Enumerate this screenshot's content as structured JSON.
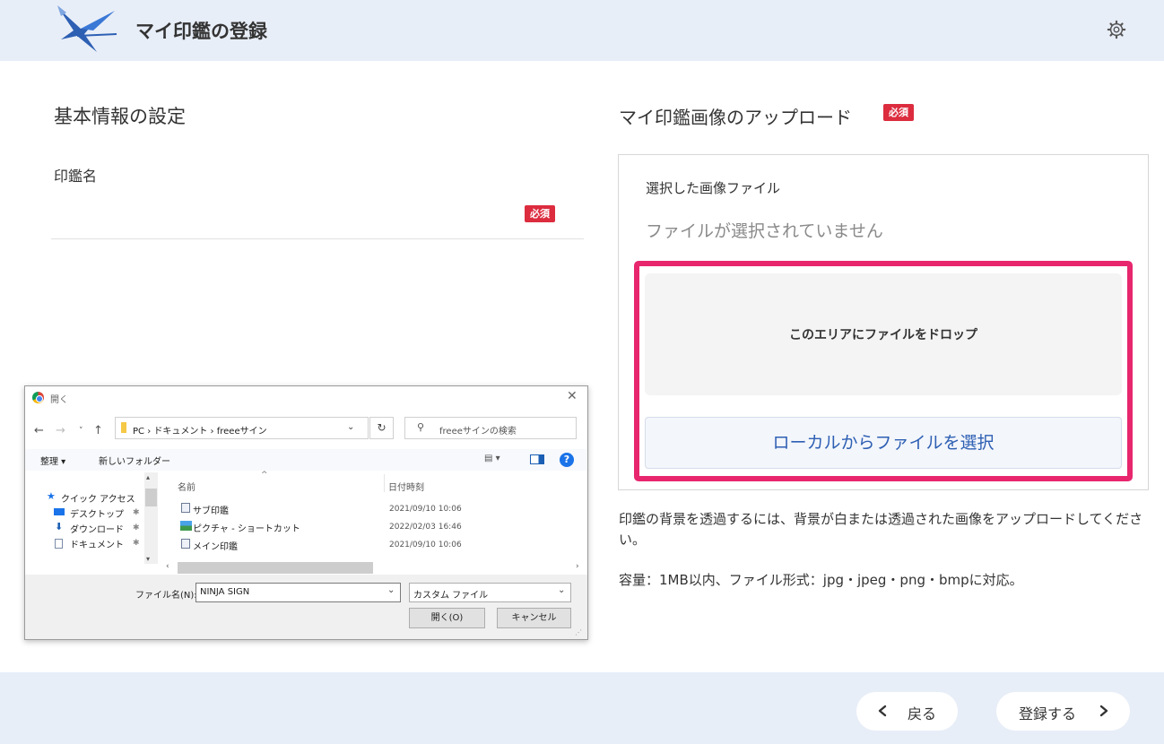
{
  "header": {
    "title": "マイ印鑑の登録",
    "logo_icon": "bird-logo-icon",
    "settings_icon": "gear-icon"
  },
  "left": {
    "section_title": "基本情報の設定",
    "field_label": "印鑑名",
    "required_badge": "必須"
  },
  "right": {
    "upload_title": "マイ印鑑画像のアップロード",
    "required_badge": "必須",
    "selected_label": "選択した画像ファイル",
    "selected_value": "ファイルが選択されていません",
    "dropzone_text": "このエリアにファイルをドロップ",
    "local_button": "ローカルからファイルを選択",
    "note1": "印鑑の背景を透過するには、背景が白または透過された画像をアップロードしてください。",
    "note2": "容量：1MB以内、ファイル形式：jpg・jpeg・png・bmpに対応。",
    "highlight_color": "#e8266e"
  },
  "footer": {
    "back_label": "戻る",
    "next_label": "登録する"
  },
  "dialog": {
    "title": "開く",
    "close": "✕",
    "path": "PC › ドキュメント › freeeサイン",
    "refresh": "↻",
    "search_placeholder": "freeeサインの検索",
    "organize": "整理 ▾",
    "new_folder": "新しいフォルダー",
    "help": "?",
    "tree": [
      "クイック アクセス",
      "デスクトップ",
      "ダウンロード",
      "ドキュメント"
    ],
    "col_name": "名前",
    "col_date": "日付時刻",
    "files": [
      {
        "name": "サブ印鑑",
        "date": "2021/09/10 10:06"
      },
      {
        "name": "ピクチャ - ショートカット",
        "date": "2022/02/03 16:46"
      },
      {
        "name": "メイン印鑑",
        "date": "2021/09/10 10:06"
      }
    ],
    "filename_label": "ファイル名(N):",
    "filename_value": "NINJA SIGN",
    "filetype_value": "カスタム ファイル",
    "open_button": "開く(O)",
    "cancel_button": "キャンセル"
  }
}
